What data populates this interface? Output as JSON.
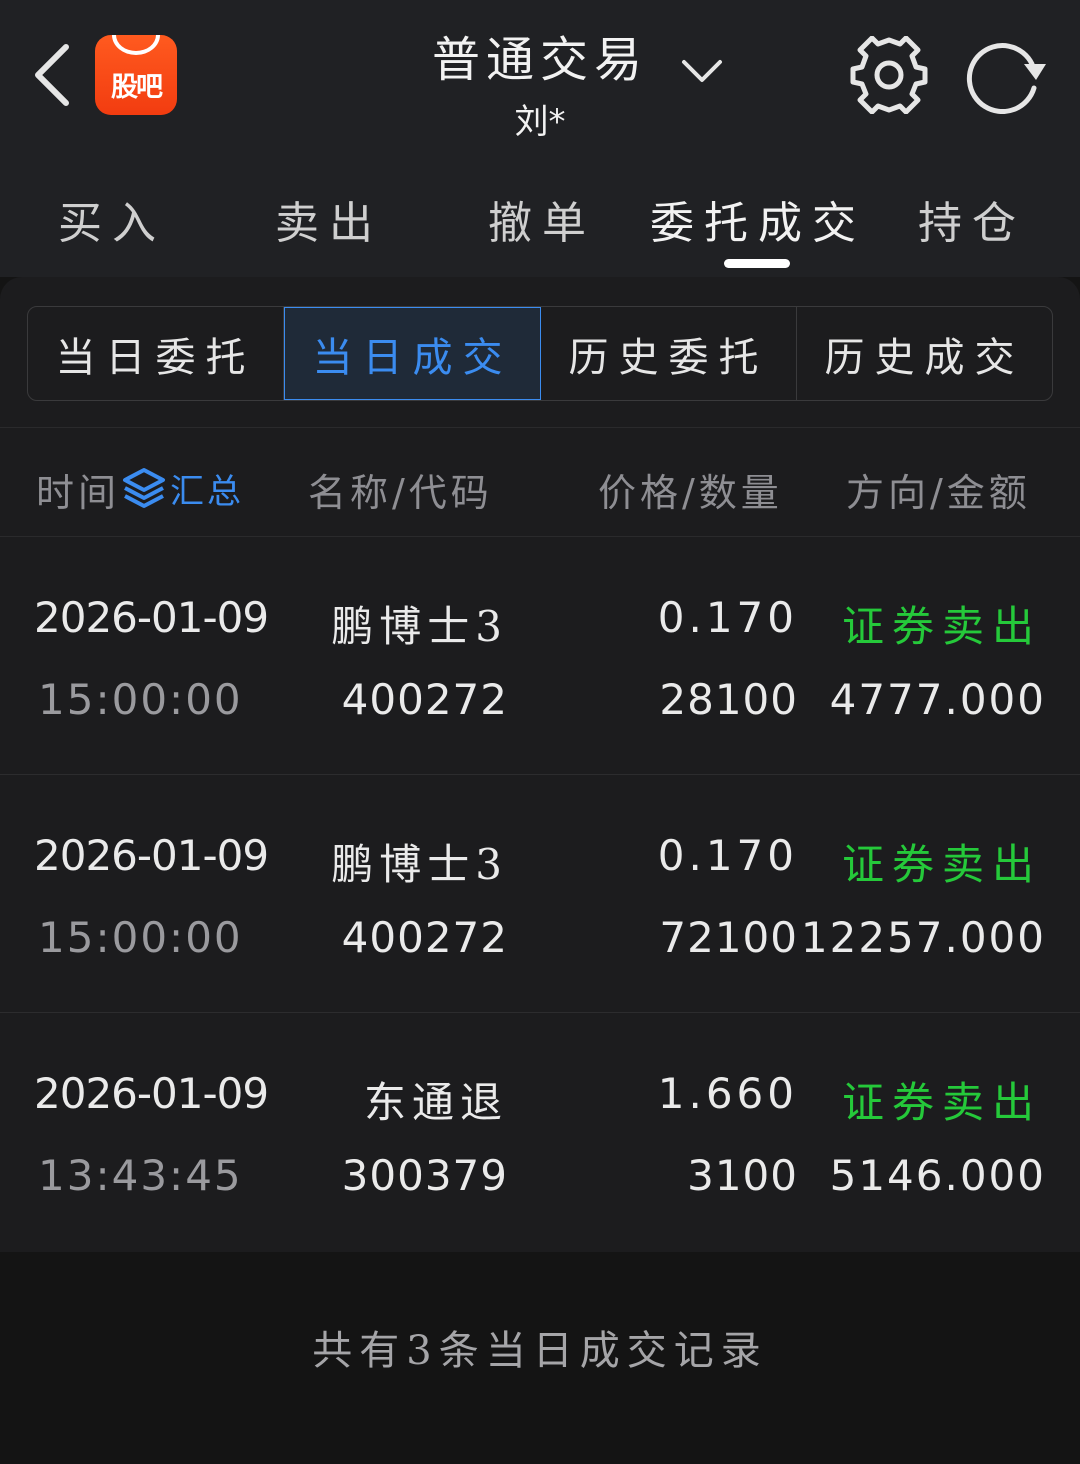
{
  "header": {
    "logo_text": "股吧",
    "title": "普通交易",
    "account": "刘*"
  },
  "tabs": [
    {
      "label": "买入"
    },
    {
      "label": "卖出"
    },
    {
      "label": "撤单"
    },
    {
      "label": "委托成交",
      "active": true
    },
    {
      "label": "持仓"
    }
  ],
  "segments": [
    {
      "label": "当日委托"
    },
    {
      "label": "当日成交",
      "active": true
    },
    {
      "label": "历史委托"
    },
    {
      "label": "历史成交"
    }
  ],
  "columns": {
    "time": "时间",
    "summary": "汇总",
    "name_code": "名称/代码",
    "price_qty": "价格/数量",
    "dir_amount": "方向/金额"
  },
  "rows": [
    {
      "date": "2026-01-09",
      "time": "15:00:00",
      "name": "鹏博士3",
      "code": "400272",
      "price": "0.170",
      "qty": "28100",
      "direction": "证券卖出",
      "amount": "4777.000"
    },
    {
      "date": "2026-01-09",
      "time": "15:00:00",
      "name": "鹏博士3",
      "code": "400272",
      "price": "0.170",
      "qty": "72100",
      "direction": "证券卖出",
      "amount": "12257.000"
    },
    {
      "date": "2026-01-09",
      "time": "13:43:45",
      "name": "东通退",
      "code": "300379",
      "price": "1.660",
      "qty": "3100",
      "direction": "证券卖出",
      "amount": "5146.000"
    }
  ],
  "footer": {
    "summary_text": "共有3条当日成交记录"
  },
  "colors": {
    "accent": "#3b8cf0",
    "sell": "#25c93a",
    "logo": "#f23c10"
  }
}
